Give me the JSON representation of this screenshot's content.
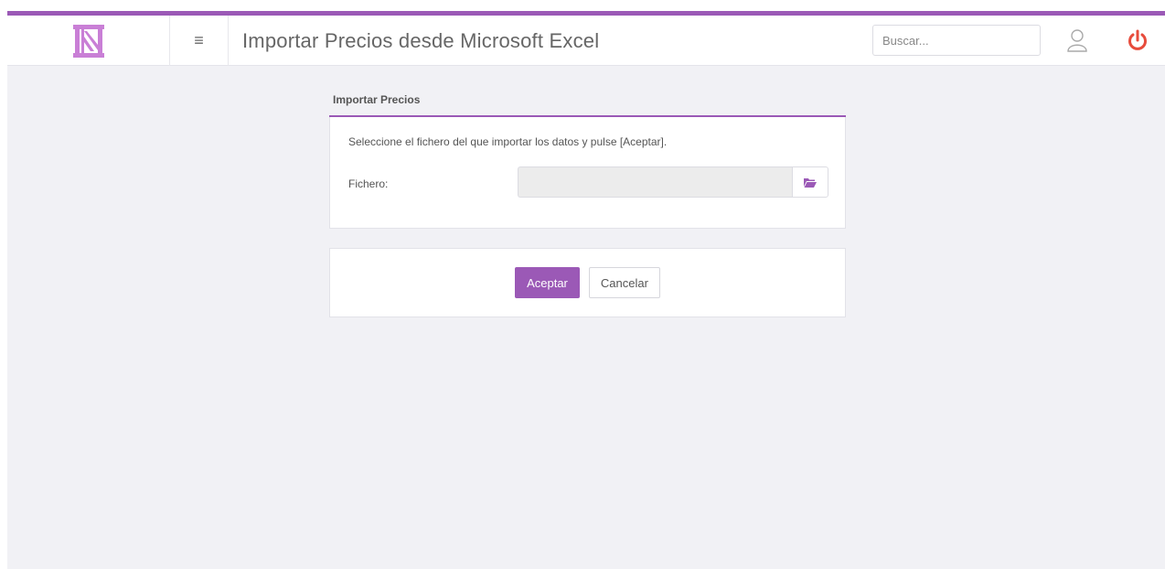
{
  "header": {
    "logo_icon": "columns-logo-icon",
    "menu_icon": "hamburger-icon",
    "title": "Importar Precios desde Microsoft Excel",
    "search_placeholder": "Buscar...",
    "user_icon": "user-icon",
    "power_icon": "power-icon"
  },
  "import_panel": {
    "heading": "Importar Precios",
    "instructions": "Seleccione el fichero del que importar los datos y pulse [Aceptar].",
    "file_label": "Fichero:",
    "file_value": "",
    "browse_icon": "folder-open-icon"
  },
  "actions": {
    "accept_label": "Aceptar",
    "cancel_label": "Cancelar"
  },
  "colors": {
    "accent": "#9b59b6",
    "power": "#e74c3c",
    "background": "#f1f1f5"
  }
}
